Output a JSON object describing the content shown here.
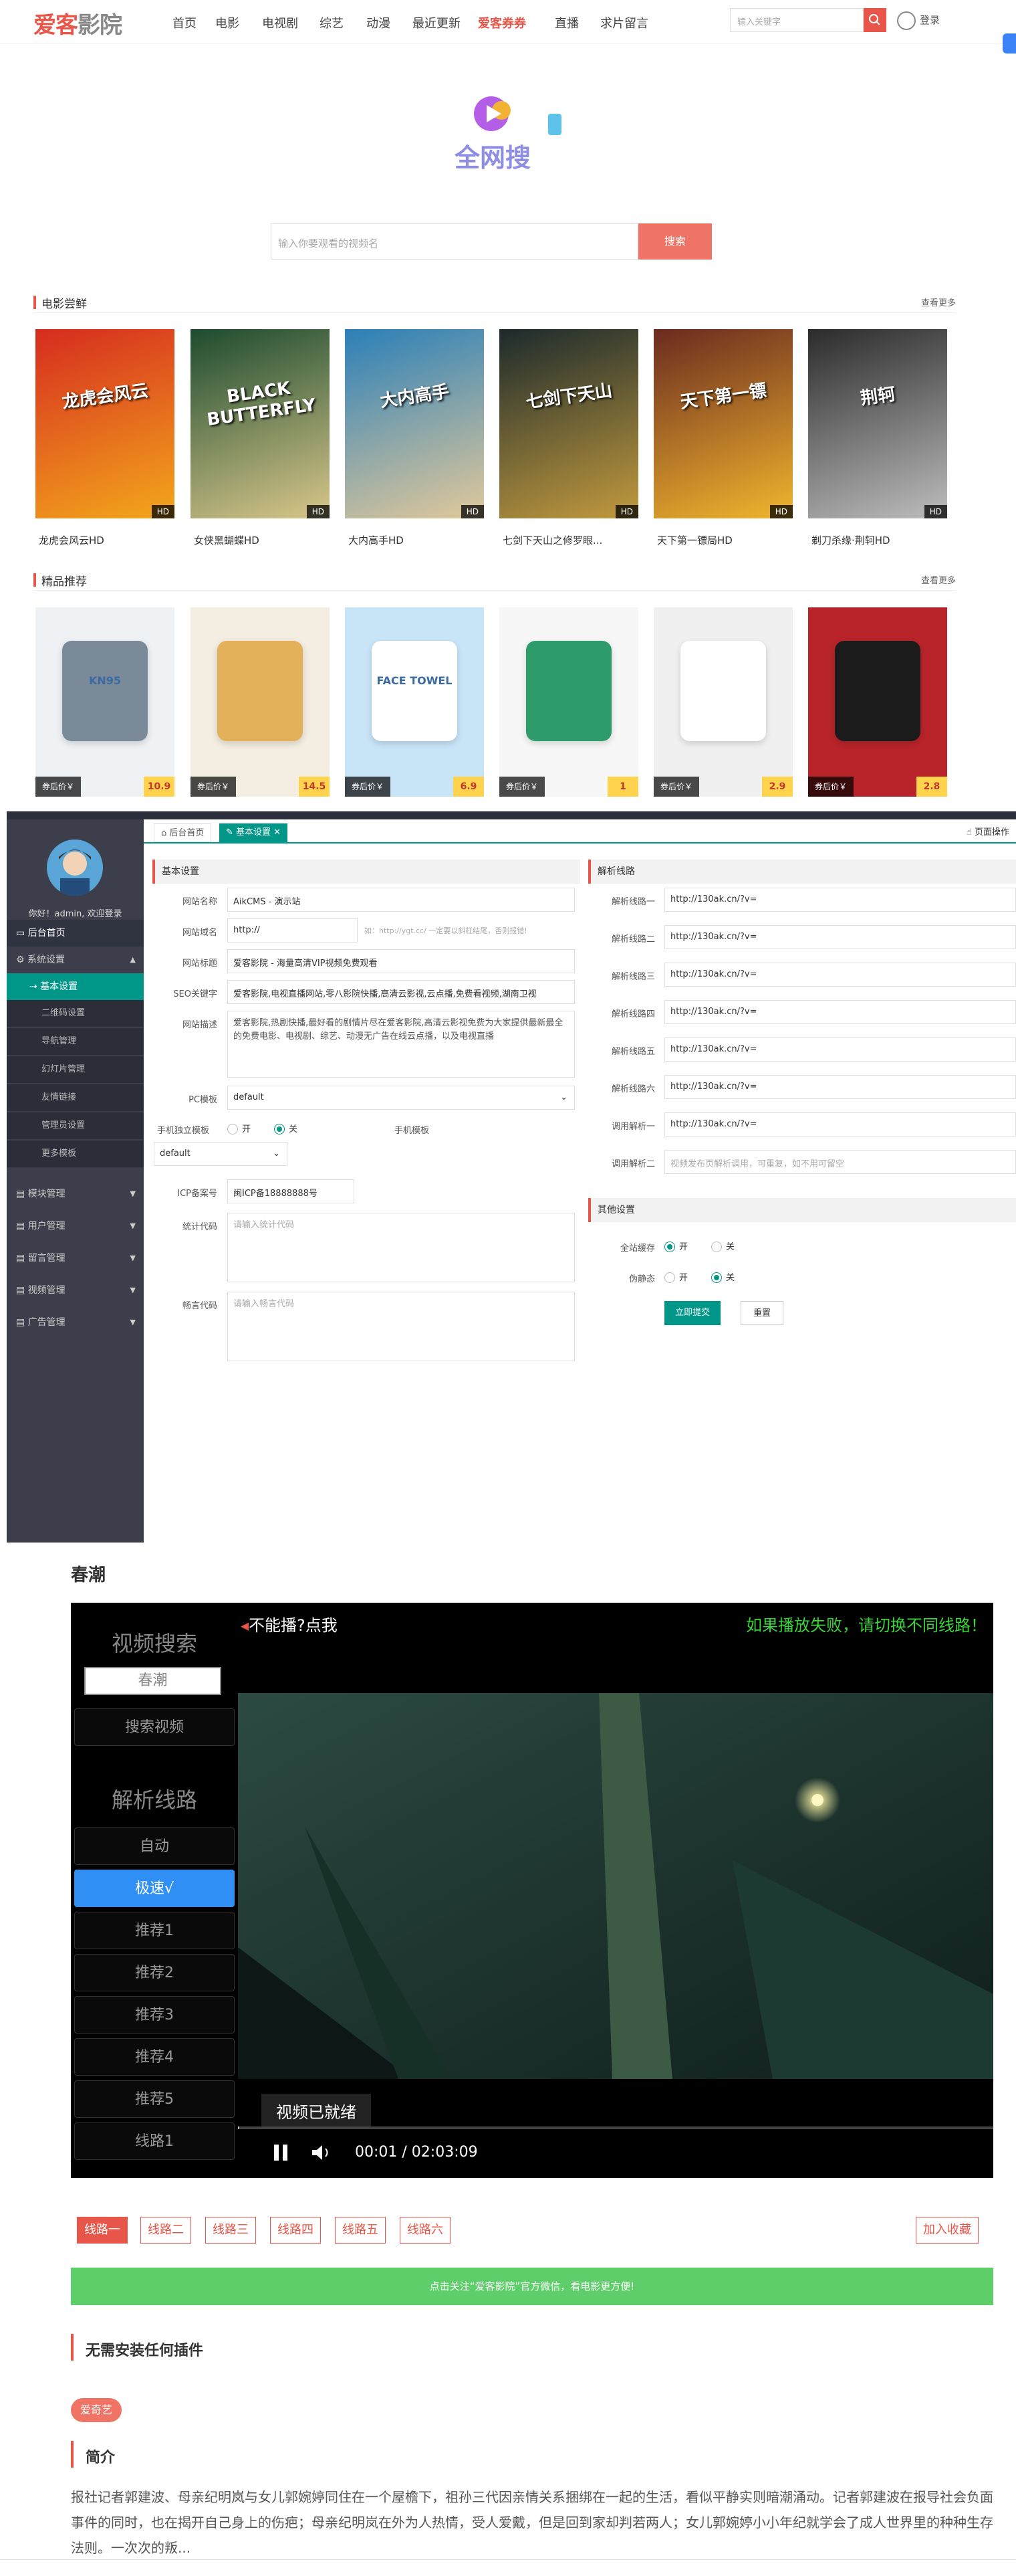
{
  "site": {
    "logo": {
      "part1": "爱客",
      "part2": "影院"
    },
    "nav": [
      "首页",
      "电影",
      "电视剧",
      "综艺",
      "动漫",
      "最近更新",
      "爱客券券",
      "直播",
      "求片留言"
    ],
    "nav_hot_index": 6,
    "search_placeholder": "输入关键字",
    "login_label": "登录",
    "quanwangsou_label": "全网搜",
    "big_search_placeholder": "输入你要观看的视频名",
    "big_search_button": "搜索",
    "movies_section": {
      "title": "电影尝鲜",
      "more": "查看更多"
    },
    "movies": [
      {
        "title": "龙虎会风云HD",
        "poster_text": "龙虎会风云",
        "badge": "HD",
        "colors": [
          "#d62c1f",
          "#f3a71c"
        ]
      },
      {
        "title": "女侠黑蝴蝶HD",
        "poster_text": "BLACK BUTTERFLY",
        "badge": "HD",
        "colors": [
          "#1d4b2f",
          "#d8c78a"
        ]
      },
      {
        "title": "大内高手HD",
        "poster_text": "大内高手",
        "badge": "HD",
        "colors": [
          "#2a7fb8",
          "#e2c99b"
        ]
      },
      {
        "title": "七剑下天山之修罗眼...",
        "poster_text": "七剑下天山",
        "badge": "HD",
        "colors": [
          "#1c2a2c",
          "#c29a3e"
        ]
      },
      {
        "title": "天下第一镖局HD",
        "poster_text": "天下第一镖",
        "badge": "HD",
        "colors": [
          "#6b2a1f",
          "#f0b62e"
        ]
      },
      {
        "title": "剃刀杀缘·荆轲HD",
        "poster_text": "荆轲",
        "badge": "HD",
        "colors": [
          "#2b2b2b",
          "#bdbdbd"
        ]
      }
    ],
    "products_section": {
      "title": "精品推荐",
      "more": "查看更多"
    },
    "products": [
      {
        "coupon": "券后价￥",
        "price": "10.9",
        "label": "KN95",
        "bg": "#eef2f5",
        "fg": "#7a8a99"
      },
      {
        "coupon": "券后价￥",
        "price": "14.5",
        "label": "",
        "bg": "#f4ede1",
        "fg": "#e3b15a"
      },
      {
        "coupon": "券后价￥",
        "price": "6.9",
        "label": "FACE TOWEL",
        "bg": "#c8e4f7",
        "fg": "#ffffff"
      },
      {
        "coupon": "券后价￥",
        "price": "1",
        "label": "",
        "bg": "#f7f7f7",
        "fg": "#2e9b6a"
      },
      {
        "coupon": "券后价￥",
        "price": "2.9",
        "label": "",
        "bg": "#f0f0f0",
        "fg": "#ffffff"
      },
      {
        "coupon": "券后价￥",
        "price": "2.8",
        "label": "",
        "bg": "#b8242a",
        "fg": "#1b1b1b"
      }
    ]
  },
  "admin": {
    "greeting": "你好！admin, 欢迎登录",
    "menu_home": "后台首页",
    "menu_system": "系统设置",
    "menu_active": "基本设置",
    "menu_subs": [
      "二维码设置",
      "导航管理",
      "幻灯片管理",
      "友情链接",
      "管理员设置",
      "更多模板"
    ],
    "menu_groups": [
      "模块管理",
      "用户管理",
      "留言管理",
      "视频管理",
      "广告管理"
    ],
    "tabs": [
      "后台首页",
      "基本设置"
    ],
    "page_ops": "页面操作",
    "basic_title": "基本设置",
    "fields": {
      "site_name_label": "网站名称",
      "site_name": "AikCMS - 演示站",
      "site_url_label": "网站域名",
      "site_url": "http://",
      "site_url_hint": "如：http://ygt.cc/ 一定要以斜杠结尾，否则报错!",
      "site_title_label": "网站标题",
      "site_title": "爱客影院 - 海量高清VIP视频免费观看",
      "seo_label": "SEO关键字",
      "seo": "爱客影院,电视直播网站,零八影院快播,高清云影视,云点播,免费看视频,湖南卫视",
      "desc_label": "网站描述",
      "desc": "爱客影院,热剧快播,最好看的剧情片尽在爱客影院,高清云影视免费为大家提供最新最全的免费电影、电视剧、综艺、动漫无广告在线云点播，以及电视直播",
      "pc_tpl_label": "PC模板",
      "pc_tpl": "default",
      "mobile_label": "手机独立模板",
      "radio_on": "开",
      "radio_off": "关",
      "mobile_tpl_label": "手机模板",
      "mobile_tpl": "default",
      "icp_label": "ICP备案号",
      "icp": "闽ICP备18888888号",
      "stats_label": "统计代码",
      "stats_ph": "请输入统计代码",
      "union_label": "畅言代码",
      "union_ph": "请输入畅言代码"
    },
    "parse_title": "解析线路",
    "parse_lines": [
      {
        "label": "解析线路一",
        "value": "http://130ak.cn/?v="
      },
      {
        "label": "解析线路二",
        "value": "http://130ak.cn/?v="
      },
      {
        "label": "解析线路三",
        "value": "http://130ak.cn/?v="
      },
      {
        "label": "解析线路四",
        "value": "http://130ak.cn/?v="
      },
      {
        "label": "解析线路五",
        "value": "http://130ak.cn/?v="
      },
      {
        "label": "解析线路六",
        "value": "http://130ak.cn/?v="
      },
      {
        "label": "调用解析一",
        "value": "http://130ak.cn/?v="
      },
      {
        "label": "调用解析二",
        "value": "视频发布页解析调用，可重复，如不用可留空"
      }
    ],
    "other_title": "其他设置",
    "cache_label": "全站缓存",
    "pseudo_label": "伪静态",
    "submit": "立即提交",
    "reset": "重置"
  },
  "player": {
    "title": "春潮",
    "left": {
      "search_heading": "视频搜索",
      "search_value": "春潮",
      "search_btn": "搜索视频",
      "parse_heading": "解析线路",
      "lines": [
        "自动",
        "极速√",
        "推荐1",
        "推荐2",
        "推荐3",
        "推荐4",
        "推荐5",
        "线路1"
      ],
      "selected_index": 1
    },
    "top_left": "不能播?点我",
    "top_right": "如果播放失败，请切换不同线路！",
    "status": "视频已就绪",
    "time": "00:01 / 02:03:09",
    "progress": 0.0001,
    "line_buttons": [
      "线路一",
      "线路二",
      "线路三",
      "线路四",
      "线路五",
      "线路六"
    ],
    "fav_button": "加入收藏",
    "notice": "点击关注“爱客影院”官方微信，看电影更方便!",
    "plugin_heading": "无需安装任何插件",
    "source_tag": "爱奇艺",
    "intro_heading": "简介",
    "intro": "报社记者郭建波、母亲纪明岚与女儿郭婉婷同住在一个屋檐下，祖孙三代因亲情关系捆绑在一起的生活，看似平静实则暗潮涌动。记者郭建波在报导社会负面事件的同时，也在揭开自己身上的伤疤；母亲纪明岚在外为人热情，受人爱戴，但是回到家却判若两人；女儿郭婉婷小小年纪就学会了成人世界里的种种生存法则。一次次的叛..."
  }
}
